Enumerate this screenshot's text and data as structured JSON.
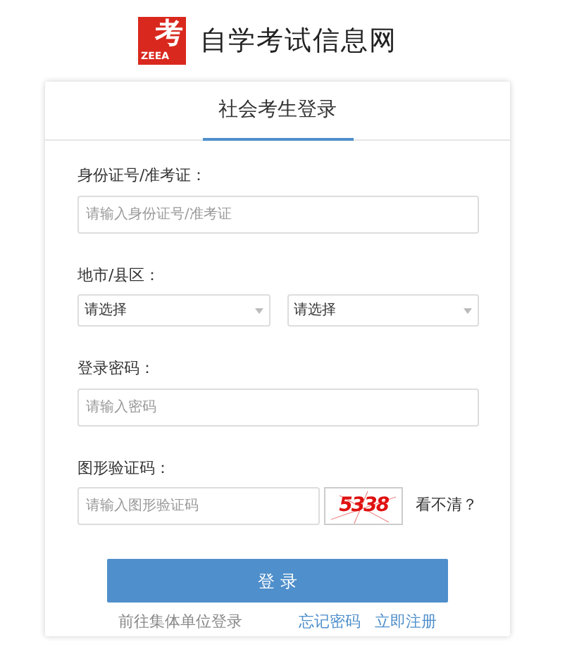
{
  "header": {
    "logo_char": "考",
    "logo_abbr": "ZEEA",
    "site_title": "自学考试信息网"
  },
  "tabs": [
    {
      "label": "社会考生登录",
      "selected": true
    }
  ],
  "form": [
    {
      "kind": "input",
      "label": "身份证号/准考证：",
      "placeholder": "请输入身份证号/准考证"
    },
    {
      "kind": "selects",
      "label": "地市/县区：",
      "options": [
        "请选择",
        "请选择"
      ]
    },
    {
      "kind": "input",
      "label": "登录密码：",
      "placeholder": "请输入密码"
    },
    {
      "kind": "captcha",
      "label": "图形验证码：",
      "placeholder": "请输入图形验证码",
      "captcha": "5338",
      "refresh": "看不清？"
    }
  ],
  "submit": "登 录",
  "links": {
    "group_login": "前往集体单位登录",
    "forgot": "忘记密码",
    "register": "立即注册"
  }
}
